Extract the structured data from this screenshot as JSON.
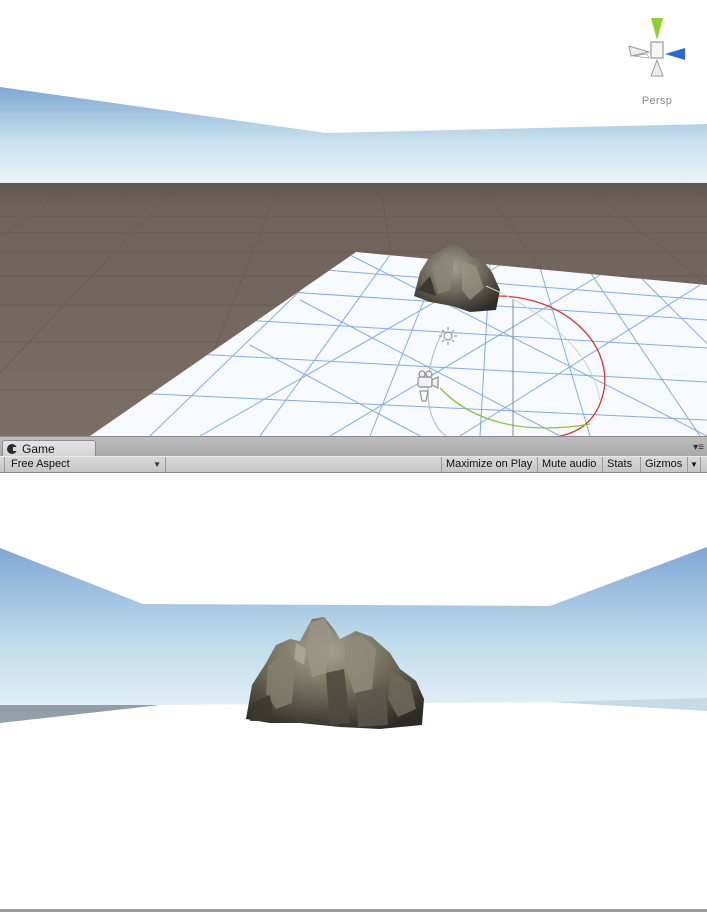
{
  "scene": {
    "projection_label": "Persp",
    "gizmo_axes": [
      "y-axis-cone",
      "x-axis-cone",
      "z-axis-cone",
      "neg-x-cone",
      "neg-y-cone"
    ]
  },
  "game": {
    "tab_label": "Game",
    "toolbar": {
      "aspect_label": "Free Aspect",
      "maximize_label": "Maximize on Play",
      "mute_label": "Mute audio",
      "stats_label": "Stats",
      "gizmos_label": "Gizmos"
    }
  },
  "icons": {
    "tab_icon": "game-controller-icon",
    "panel_menu": "panel-menu-icon",
    "dropdown": "dropdown-arrow-icon"
  },
  "colors": {
    "sky_top": "#7fa8d4",
    "sky_horizon": "#e6f2f7",
    "ground": "#75695f",
    "plane_grid": "#6f9ee0",
    "gizmo_y": "#8ed22a",
    "gizmo_x": "#2c67d8",
    "arc_red": "#d8372a",
    "arc_green": "#8bc53a"
  }
}
